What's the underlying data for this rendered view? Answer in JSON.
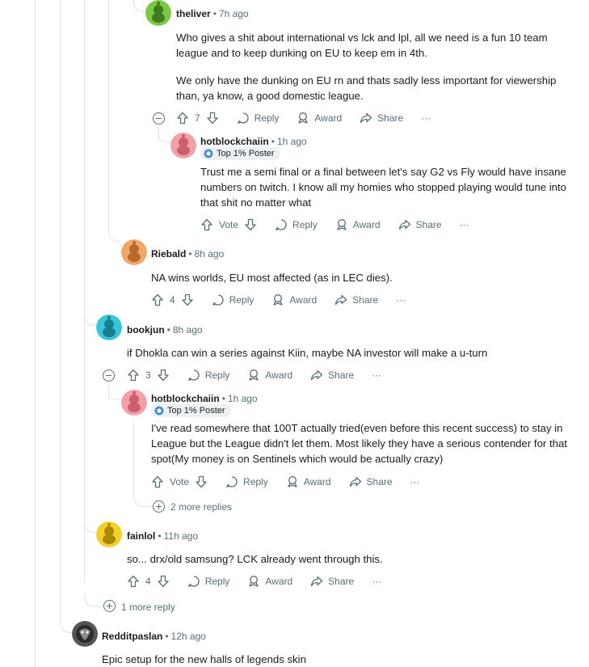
{
  "comments": [
    {
      "author": "theliver",
      "time": "7h ago",
      "paragraphs": [
        "Who gives a shit about international vs lck and lpl, all we need is a fun 10 team league and to keep dunking on EU to keep em in 4th.",
        "We only have the dunking on EU rn and thats sadly less important for viewership than, ya know, a good domestic league."
      ],
      "votes": "7",
      "avatar_color": "#7ac943"
    },
    {
      "author": "hotblockchaiin",
      "time": "1h ago",
      "flair": "Top 1% Poster",
      "paragraphs": [
        "Trust me a semi final or a final between let's say G2 vs Fly would have insane numbers on twitch. I know all my homies who stopped playing would tune into that shit no matter what"
      ],
      "votes": "Vote",
      "avatar_color": "#f4a0a8"
    },
    {
      "author": "Riebald",
      "time": "8h ago",
      "paragraphs": [
        "NA wins worlds, EU most affected (as in LEC dies)."
      ],
      "votes": "4",
      "avatar_color": "#f0a86a"
    },
    {
      "author": "bookjun",
      "time": "8h ago",
      "paragraphs": [
        "if Dhokla can win a series against Kiin, maybe NA investor will make a u-turn"
      ],
      "votes": "3",
      "avatar_color": "#35c7d8"
    },
    {
      "author": "hotblockchaiin",
      "time": "1h ago",
      "flair": "Top 1% Poster",
      "paragraphs": [
        "I've read somewhere that 100T actually tried(even before this recent success) to stay in League but the League didn't let them. Most likely they have a serious contender for that spot(My money is on Sentinels which would be actually crazy)"
      ],
      "votes": "Vote",
      "avatar_color": "#f4a0a8"
    },
    {
      "author": "fainlol",
      "time": "11h ago",
      "paragraphs": [
        "so... drx/old samsung? LCK already went through this."
      ],
      "votes": "4",
      "avatar_color": "#f2cf2b"
    },
    {
      "author": "Redditpaslan",
      "time": "12h ago",
      "paragraphs": [
        "Epic setup for the new halls of legends skin"
      ],
      "avatar_color": "#555555"
    }
  ],
  "labels": {
    "reply": "Reply",
    "award": "Award",
    "share": "Share",
    "more": "···"
  },
  "more_replies": {
    "two": "2 more replies",
    "one": "1 more reply"
  },
  "separator": "•"
}
